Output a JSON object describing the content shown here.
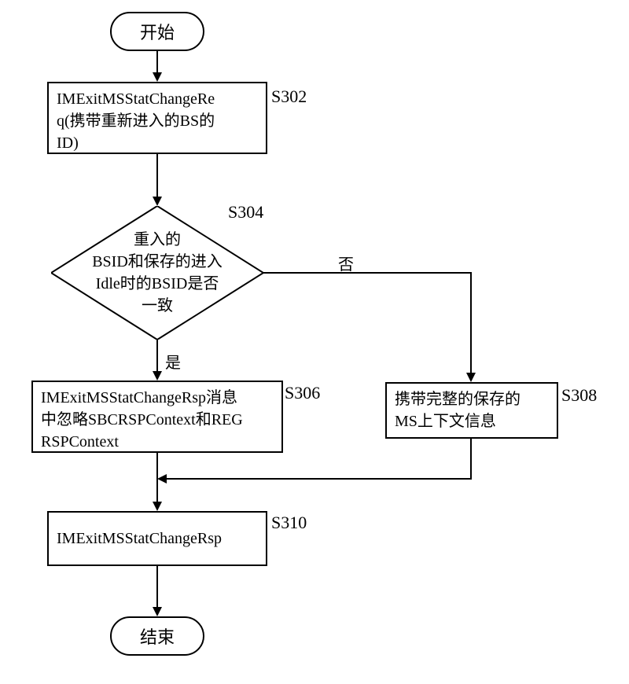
{
  "chart_data": {
    "type": "flowchart",
    "nodes": [
      {
        "id": "start",
        "type": "terminator",
        "label": "开始"
      },
      {
        "id": "s302",
        "type": "process",
        "label": "IMExitMSStatChangeReq(携带重新进入的BS的ID)",
        "step": "S302"
      },
      {
        "id": "s304",
        "type": "decision",
        "label": "重入的BSID和保存的进入Idle时的BSID是否一致",
        "step": "S304"
      },
      {
        "id": "s306",
        "type": "process",
        "label": "IMExitMSStatChangeRsp消息中忽略SBCRSPContext和REGRSPContext",
        "step": "S306"
      },
      {
        "id": "s308",
        "type": "process",
        "label": "携带完整的保存的MS上下文信息",
        "step": "S308"
      },
      {
        "id": "s310",
        "type": "process",
        "label": "IMExitMSStatChangeRsp",
        "step": "S310"
      },
      {
        "id": "end",
        "type": "terminator",
        "label": "结束"
      }
    ],
    "edges": [
      {
        "from": "start",
        "to": "s302"
      },
      {
        "from": "s302",
        "to": "s304"
      },
      {
        "from": "s304",
        "to": "s306",
        "label": "是"
      },
      {
        "from": "s304",
        "to": "s308",
        "label": "否"
      },
      {
        "from": "s306",
        "to": "s310"
      },
      {
        "from": "s308",
        "to": "s310"
      },
      {
        "from": "s310",
        "to": "end"
      }
    ]
  },
  "start": {
    "label": "开始"
  },
  "step302": {
    "line1": "IMExitMSStatChangeRe",
    "line2": "q(携带重新进入的BS的",
    "line3": "ID)",
    "label": "S302"
  },
  "step304": {
    "line1": "重入的",
    "line2": "BSID和保存的进入",
    "line3": "Idle时的BSID是否",
    "line4": "一致",
    "label": "S304"
  },
  "step306": {
    "line1": "IMExitMSStatChangeRsp消息",
    "line2": "中忽略SBCRSPContext和REG",
    "line3": "RSPContext",
    "label": "S306"
  },
  "step308": {
    "line1": "携带完整的保存的",
    "line2": "MS上下文信息",
    "label": "S308"
  },
  "step310": {
    "line1": "IMExitMSStatChangeRsp",
    "label": "S310"
  },
  "end": {
    "label": "结束"
  },
  "branches": {
    "yes": "是",
    "no": "否"
  }
}
